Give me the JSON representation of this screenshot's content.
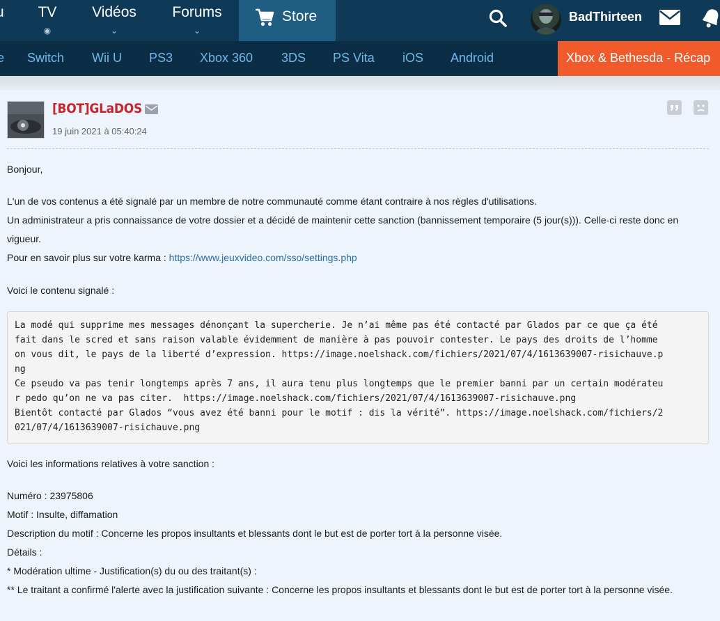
{
  "nav": {
    "clip_label": "u",
    "tv": {
      "label": "TV",
      "sub": "◉"
    },
    "videos": {
      "label": "Vidéos",
      "sub": "⌄"
    },
    "forums": {
      "label": "Forums",
      "sub": "⌄"
    },
    "store": {
      "label": "Store",
      "icon": "cart-icon"
    },
    "search_icon": "search-icon",
    "user": {
      "name": "BadThirteen",
      "avatar": "avatar"
    },
    "mail_icon": "mail-icon",
    "bell_icon": "bell-icon"
  },
  "platforms": {
    "items": [
      {
        "label": "e"
      },
      {
        "label": "Switch"
      },
      {
        "label": "Wii U"
      },
      {
        "label": "PS3"
      },
      {
        "label": "Xbox 360"
      },
      {
        "label": "3DS"
      },
      {
        "label": "PS Vita"
      },
      {
        "label": "iOS"
      },
      {
        "label": "Android"
      }
    ],
    "promo": "Xbox & Bethesda - Récap"
  },
  "message": {
    "author": "[BOT]GLaDOS",
    "date": "19 juin 2021 à 05:40:24",
    "greeting": "Bonjour,",
    "line1": "L'un de vos contenus a été signalé par un membre de notre communauté comme étant contraire à nos règles d'utilisations.",
    "line2": "Un administrateur a pris connaissance de votre dossier et a décidé de maintenir cette sanction (bannissement temporaire (5 jour(s))). Celle-ci reste donc en vigueur.",
    "line3_prefix": "Pour en savoir plus sur votre karma : ",
    "line3_link": "https://www.jeuxvideo.com/sso/settings.php",
    "reported_intro": "Voici le contenu signalé :",
    "reported_content": "La modé qui supprime mes messages dénonçant la supercherie. Je n’ai même pas été contacté par Glados par ce que ça été\nfait dans le scred et sans raison valable évidemment de manière à pas pouvoir contester. Le pays des droits de l’homme\non vous dit, le pays de la liberté d’expression. https://image.noelshack.com/fichiers/2021/07/4/1613639007-risichauve.p\nng\nCe pseudo va pas tenir longtemps après 7 ans, il aura tenu plus longtemps que le premier banni par un certain modérateu\nr pedo qu’on ne va pas citer.  https://image.noelshack.com/fichiers/2021/07/4/1613639007-risichauve.png\nBientôt contacté par Glados “vous avez été banni pour le motif : dis la vérité”. https://image.noelshack.com/fichiers/2\n021/07/4/1613639007-risichauve.png",
    "sanction_intro": "Voici les informations relatives à votre sanction :",
    "numero": "Numéro : 23975806",
    "motif": "Motif : Insulte, diffamation",
    "description": "Description du motif : Concerne les propos insultants et blessants dont le but est de porter tort à la personne visée.",
    "details": "Détails :",
    "detail1": "* Modération ultime - Justification(s) du ou des traitant(s) :",
    "detail2": "** Le traitant a confirmé l'alerte avec la justification suivante : Concerne les propos insultants et blessants dont le but est de porter tort à la personne visée."
  },
  "colors": {
    "topbar": "#0e3a57",
    "platbar": "#0b2d45",
    "store": "#1f5d83",
    "promo": "#f15a2b",
    "author": "#c4262e",
    "link": "#2a6ea6"
  }
}
